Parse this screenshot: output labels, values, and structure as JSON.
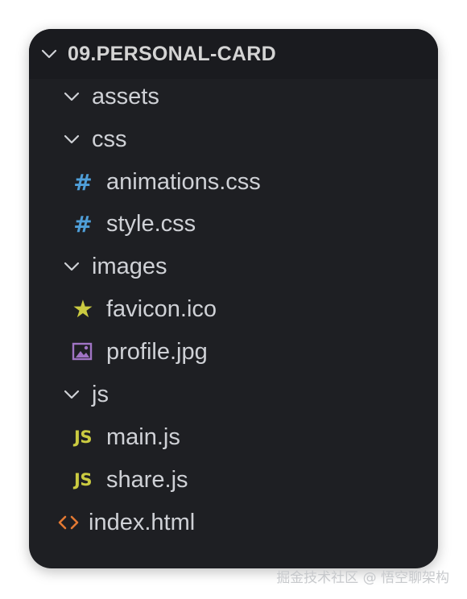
{
  "explorer": {
    "root": {
      "label": "09.PERSONAL-CARD",
      "icon": "chevron-down-icon"
    },
    "items": [
      {
        "label": "assets",
        "type": "folder",
        "icon": "chevron-down-icon"
      },
      {
        "label": "css",
        "type": "folder",
        "icon": "chevron-down-icon"
      },
      {
        "label": "animations.css",
        "type": "file",
        "icon": "css-hash-icon",
        "icon_glyph": "#"
      },
      {
        "label": "style.css",
        "type": "file",
        "icon": "css-hash-icon",
        "icon_glyph": "#"
      },
      {
        "label": "images",
        "type": "folder",
        "icon": "chevron-down-icon"
      },
      {
        "label": "favicon.ico",
        "type": "file",
        "icon": "star-icon",
        "icon_glyph": "★"
      },
      {
        "label": "profile.jpg",
        "type": "file",
        "icon": "image-icon"
      },
      {
        "label": "js",
        "type": "folder",
        "icon": "chevron-down-icon"
      },
      {
        "label": "main.js",
        "type": "file",
        "icon": "js-icon",
        "icon_glyph": "JS"
      },
      {
        "label": "share.js",
        "type": "file",
        "icon": "js-icon",
        "icon_glyph": "JS"
      },
      {
        "label": "index.html",
        "type": "file",
        "icon": "html-brackets-icon"
      }
    ],
    "colors": {
      "background": "#1e1f23",
      "text": "#cfd1d6",
      "css_icon": "#4f9fd9",
      "js_icon": "#cbcb41",
      "star_icon": "#cbcb41",
      "image_icon": "#a074c4",
      "html_icon": "#e37933"
    }
  },
  "watermark": "掘金技术社区 @ 悟空聊架构"
}
